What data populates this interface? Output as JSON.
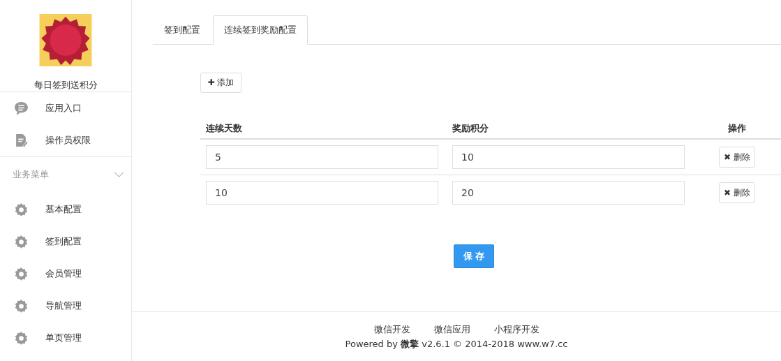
{
  "sidebar": {
    "app_name": "每日签到送积分",
    "top_items": [
      {
        "label": "应用入口",
        "kind": "chat"
      },
      {
        "label": "操作员权限",
        "kind": "doc"
      }
    ],
    "section": {
      "title": "业务菜单",
      "expanded": true
    },
    "items": [
      {
        "label": "基本配置",
        "kind": "gear"
      },
      {
        "label": "签到配置",
        "kind": "gear"
      },
      {
        "label": "会员管理",
        "kind": "gear"
      },
      {
        "label": "导航管理",
        "kind": "gear"
      },
      {
        "label": "单页管理",
        "kind": "gear"
      }
    ]
  },
  "tabs": [
    {
      "label": "签到配置",
      "selected": false
    },
    {
      "label": "连续签到奖励配置",
      "selected": true
    }
  ],
  "add_button": {
    "icon": "✚",
    "label": "添加"
  },
  "table": {
    "columns": [
      "连续天数",
      "奖励积分",
      "操作"
    ],
    "rows": [
      {
        "days": "5",
        "points": "10",
        "delete": {
          "icon": "✖",
          "label": "删除"
        }
      },
      {
        "days": "10",
        "points": "20",
        "delete": {
          "icon": "✖",
          "label": "删除"
        }
      }
    ]
  },
  "save_button": "保 存",
  "footer": {
    "links": [
      "微信开发",
      "微信应用",
      "小程序开发"
    ],
    "powered": "Powered by **微擎** v2.6.1 © 2014-2018 www.w7.cc"
  }
}
